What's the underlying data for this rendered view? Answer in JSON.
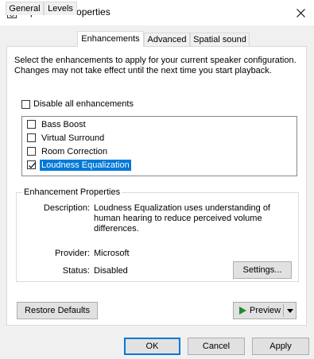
{
  "window": {
    "title": "Speakers Properties"
  },
  "tabs": [
    {
      "label": "General"
    },
    {
      "label": "Levels"
    },
    {
      "label": "Enhancements"
    },
    {
      "label": "Advanced"
    },
    {
      "label": "Spatial sound"
    }
  ],
  "active_tab": "Enhancements",
  "intro_text": "Select the enhancements to apply for your current speaker configuration. Changes may not take effect until the next time you start playback.",
  "disable_all": {
    "label": "Disable all enhancements",
    "checked": false
  },
  "enhancements": [
    {
      "label": "Bass Boost",
      "checked": false,
      "selected": false
    },
    {
      "label": "Virtual Surround",
      "checked": false,
      "selected": false
    },
    {
      "label": "Room Correction",
      "checked": false,
      "selected": false
    },
    {
      "label": "Loudness Equalization",
      "checked": true,
      "selected": true
    }
  ],
  "properties": {
    "group_title": "Enhancement Properties",
    "description_label": "Description:",
    "description_value": "Loudness Equalization uses understanding of human hearing to reduce perceived volume differences.",
    "provider_label": "Provider:",
    "provider_value": "Microsoft",
    "status_label": "Status:",
    "status_value": "Disabled",
    "settings_button": "Settings..."
  },
  "restore_defaults_button": "Restore Defaults",
  "preview_button": "Preview",
  "footer": {
    "ok": "OK",
    "cancel": "Cancel",
    "apply": "Apply"
  },
  "colors": {
    "selection": "#0078d7",
    "preview_play": "#1d8b2e"
  }
}
